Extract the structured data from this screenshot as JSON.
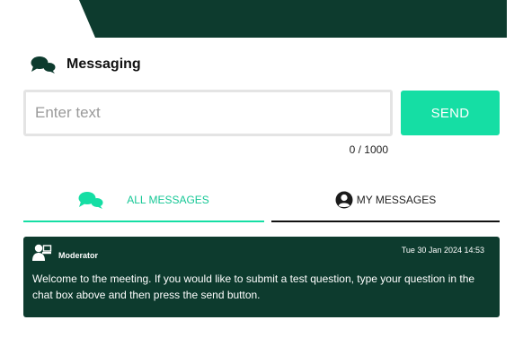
{
  "header": {
    "title": "Messaging",
    "icon": "chat-bubbles-icon"
  },
  "composer": {
    "placeholder": "Enter text",
    "value": "",
    "send_label": "SEND",
    "char_count": "0 / 1000"
  },
  "tabs": [
    {
      "label": "ALL MESSAGES",
      "icon": "chat-bubbles-icon",
      "active": true
    },
    {
      "label": "MY MESSAGES",
      "icon": "user-circle-icon",
      "active": false
    }
  ],
  "messages": [
    {
      "author": "Moderator",
      "author_icon": "presenter-icon",
      "timestamp": "Tue 30 Jan 2024 14:53",
      "text": "Welcome to the meeting. If you would like to submit a test question, type your question in the chat box above and then press the send button."
    }
  ],
  "colors": {
    "brand_dark": "#0d3b2e",
    "accent": "#15dea4",
    "active_tab_text": "#15c795"
  }
}
